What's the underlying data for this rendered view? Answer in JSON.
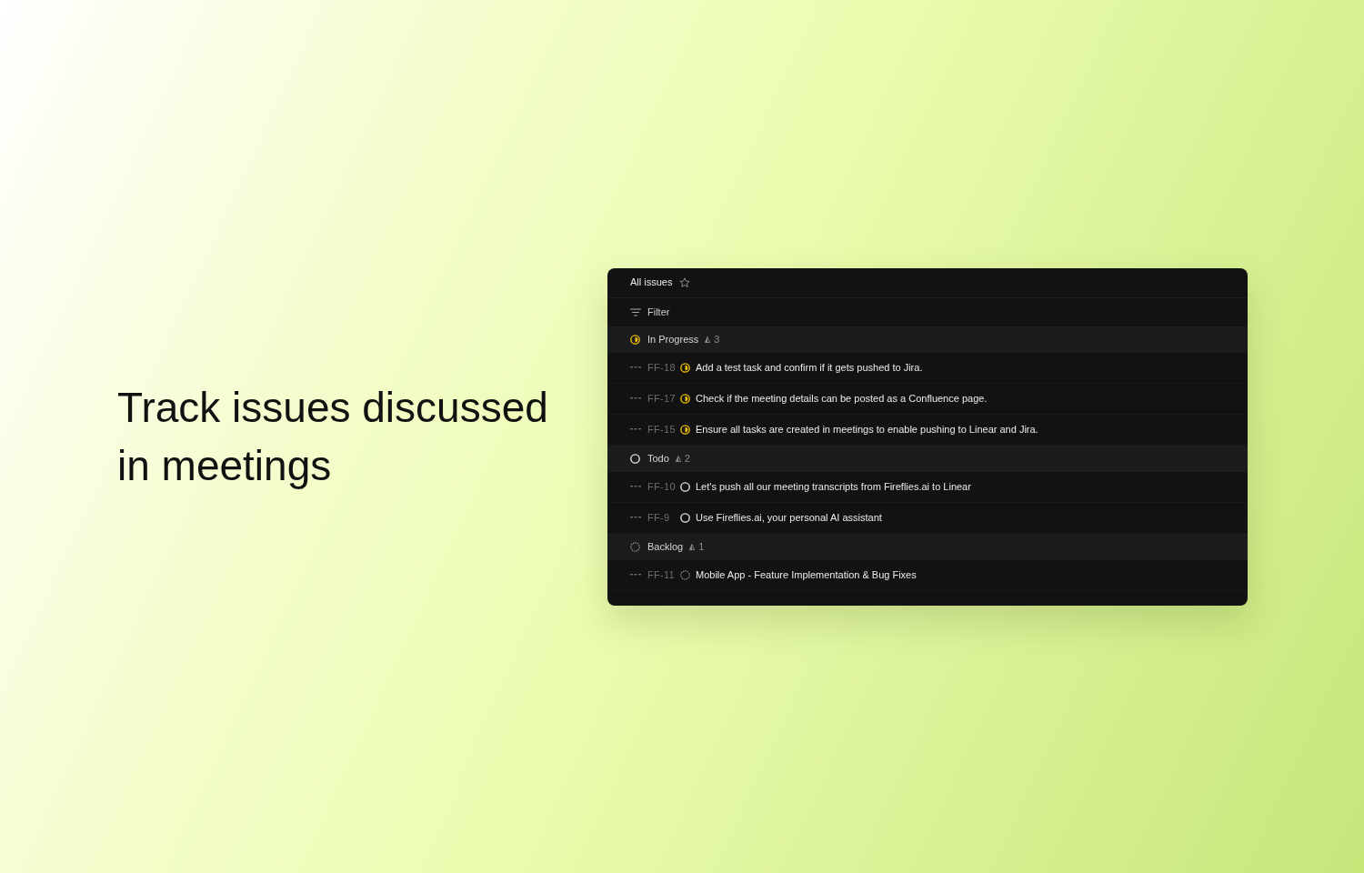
{
  "headline": "Track issues discussed in meetings",
  "issues_panel": {
    "title": "All issues",
    "filter_label": "Filter",
    "groups": [
      {
        "name": "In Progress",
        "kind": "in_progress",
        "count": "3",
        "issues": [
          {
            "id": "FF-18",
            "title": "Add a test task and confirm if it gets pushed to Jira."
          },
          {
            "id": "FF-17",
            "title": "Check if the meeting details can be posted as a Confluence page."
          },
          {
            "id": "FF-15",
            "title": "Ensure all tasks are created in meetings to enable pushing to Linear and Jira."
          }
        ]
      },
      {
        "name": "Todo",
        "kind": "todo",
        "count": "2",
        "issues": [
          {
            "id": "FF-10",
            "title": "Let's push all our meeting transcripts from Fireflies.ai to Linear"
          },
          {
            "id": "FF-9",
            "title": "Use Fireflies.ai, your personal AI assistant"
          }
        ]
      },
      {
        "name": "Backlog",
        "kind": "backlog",
        "count": "1",
        "issues": [
          {
            "id": "FF-11",
            "title": "Mobile App - Feature Implementation & Bug Fixes"
          }
        ]
      }
    ]
  }
}
